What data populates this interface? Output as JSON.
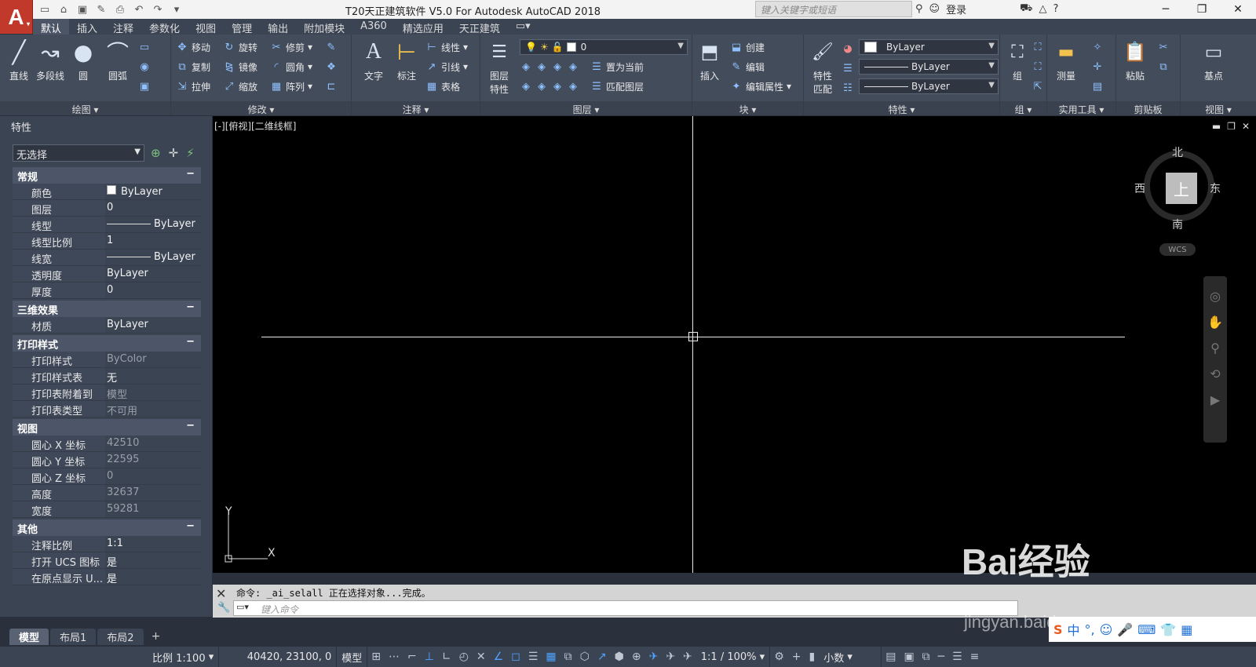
{
  "app": {
    "logo": "A",
    "title": "T20天正建筑软件 V5.0 For Autodesk AutoCAD 2018",
    "search_placeholder": "键入关键字或短语",
    "login": "登录",
    "accent": "#c0392b"
  },
  "ribbon_tabs": [
    "默认",
    "插入",
    "注释",
    "参数化",
    "视图",
    "管理",
    "输出",
    "附加模块",
    "A360",
    "精选应用",
    "天正建筑"
  ],
  "ribbon": {
    "draw": {
      "title": "绘图 ▾",
      "line": "直线",
      "polyline": "多段线",
      "circle": "圆",
      "arc": "圆弧"
    },
    "modify": {
      "title": "修改 ▾",
      "move": "移动",
      "rotate": "旋转",
      "trim": "修剪",
      "copy": "复制",
      "mirror": "镜像",
      "fillet": "圆角",
      "stretch": "拉伸",
      "scale": "缩放",
      "array": "阵列"
    },
    "annotation": {
      "title": "注释 ▾",
      "text": "文字",
      "dimension": "标注",
      "linear": "线性",
      "leader": "引线",
      "table": "表格"
    },
    "layers": {
      "title": "图层 ▾",
      "layer_props": "图层\n特性",
      "layer_value": "0",
      "set_current": "置为当前",
      "match_layer": "匹配图层",
      "layer_props_line1": "图层",
      "layer_props_line2": "特性"
    },
    "block": {
      "title": "块 ▾",
      "insert": "插入",
      "create": "创建",
      "edit": "编辑",
      "edit_attr": "编辑属性"
    },
    "properties": {
      "title": "特性 ▾",
      "match_line1": "特性",
      "match_line2": "匹配",
      "color": "ByLayer",
      "linetype": "ByLayer",
      "lineweight": "ByLayer"
    },
    "groups": {
      "title": "组 ▾",
      "group": "组"
    },
    "utilities": {
      "title": "实用工具 ▾",
      "measure": "测量"
    },
    "clipboard": {
      "title": "剪贴板",
      "paste": "粘贴"
    },
    "view": {
      "title": "视图 ▾",
      "base": "基点"
    }
  },
  "properties_palette": {
    "header": "特性",
    "selection": "无选择",
    "sections": [
      {
        "title": "常规",
        "rows": [
          {
            "key": "颜色",
            "value": "ByLayer",
            "type": "color"
          },
          {
            "key": "图层",
            "value": "0"
          },
          {
            "key": "线型",
            "value": "ByLayer",
            "type": "line"
          },
          {
            "key": "线型比例",
            "value": "1"
          },
          {
            "key": "线宽",
            "value": "ByLayer",
            "type": "line"
          },
          {
            "key": "透明度",
            "value": "ByLayer"
          },
          {
            "key": "厚度",
            "value": "0"
          }
        ]
      },
      {
        "title": "三维效果",
        "rows": [
          {
            "key": "材质",
            "value": "ByLayer"
          }
        ]
      },
      {
        "title": "打印样式",
        "rows": [
          {
            "key": "打印样式",
            "value": "ByColor",
            "dim": true
          },
          {
            "key": "打印样式表",
            "value": "无"
          },
          {
            "key": "打印表附着到",
            "value": "模型",
            "dim": true
          },
          {
            "key": "打印表类型",
            "value": "不可用",
            "dim": true
          }
        ]
      },
      {
        "title": "视图",
        "rows": [
          {
            "key": "圆心 X 坐标",
            "value": "42510",
            "dim": true
          },
          {
            "key": "圆心 Y 坐标",
            "value": "22595",
            "dim": true
          },
          {
            "key": "圆心 Z 坐标",
            "value": "0",
            "dim": true
          },
          {
            "key": "高度",
            "value": "32637",
            "dim": true
          },
          {
            "key": "宽度",
            "value": "59281",
            "dim": true
          }
        ]
      },
      {
        "title": "其他",
        "rows": [
          {
            "key": "注释比例",
            "value": "1:1"
          },
          {
            "key": "打开 UCS 图标",
            "value": "是"
          },
          {
            "key": "在原点显示 U...",
            "value": "是"
          }
        ]
      }
    ]
  },
  "viewport": {
    "label": "[-][俯视][二维线框]",
    "viewcube": {
      "north": "北",
      "south": "南",
      "east": "东",
      "west": "西",
      "face": "上"
    },
    "wcs": "WCS",
    "ucs_x": "X",
    "ucs_y": "Y"
  },
  "command": {
    "history": "命令: _ai_selall 正在选择对象...完成。",
    "placeholder": "键入命令"
  },
  "layout_tabs": [
    "模型",
    "布局1",
    "布局2"
  ],
  "status": {
    "scale": "比例 1:100",
    "coords": "40420, 23100, 0",
    "space": "模型",
    "anno_scale": "1:1 / 100%",
    "units": "小数"
  },
  "watermark": {
    "text": "Bai经验",
    "sub": "jingyan.baidu.com"
  }
}
